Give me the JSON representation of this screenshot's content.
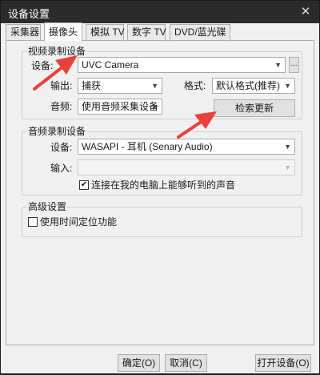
{
  "window": {
    "title": "设备设置",
    "close_glyph": "✕"
  },
  "tabs": [
    {
      "label": "采集器",
      "active": false
    },
    {
      "label": "摄像头",
      "active": true
    },
    {
      "label": "模拟 TV",
      "active": false
    },
    {
      "label": "数字 TV",
      "active": false
    },
    {
      "label": "DVD/蓝光碟",
      "active": false
    }
  ],
  "video_group": {
    "title": "视频录制设备",
    "device_label": "设备:",
    "device_value": "UVC Camera",
    "browse_label": "...",
    "output_label": "输出:",
    "output_value": "捕获",
    "format_label": "格式:",
    "format_value": "默认格式(推荐)",
    "audio_label": "音频:",
    "audio_value": "使用音频采集设备",
    "refresh_label": "检索更新"
  },
  "audio_group": {
    "title": "音频录制设备",
    "device_label": "设备:",
    "device_value": "WASAPI - 耳机 (Senary Audio)",
    "input_label": "输入:",
    "input_value": "",
    "listen_label": "连接在我的电脑上能够听到的声音",
    "listen_checked": true
  },
  "advanced_group": {
    "title": "高级设置",
    "timeshift_label": "使用时间定位功能",
    "timeshift_checked": false
  },
  "footer": {
    "ok_label": "确定(O)",
    "cancel_label": "取消(C)",
    "open_label": "打开设备(O)"
  },
  "colors": {
    "annotation_arrow": "#e8413b",
    "titlebar": "#2b2b2b"
  },
  "icons": {
    "dropdown": "chevron-down-icon",
    "check": "checkmark-icon",
    "close": "close-icon"
  }
}
